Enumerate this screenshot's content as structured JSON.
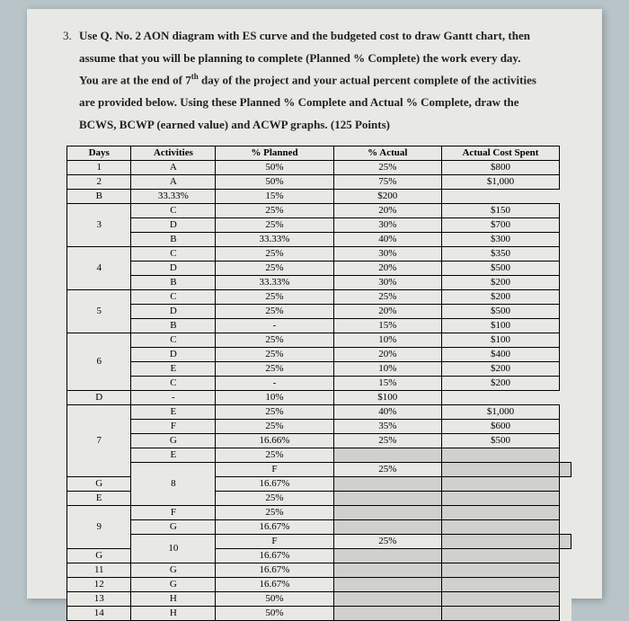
{
  "question": {
    "number": "3.",
    "line1_prefix": "Use Q. No. 2 AON diagram with ES curve and the budgeted cost to draw Gantt chart, then",
    "line2": "assume that you will be planning to complete (Planned % Complete) the work every day.",
    "line3_a": "You are at the end of 7",
    "line3_sup": "th",
    "line3_b": " day of the project and your actual percent complete of the activities",
    "line4": "are provided below. Using these Planned % Complete and Actual % Complete, draw the",
    "line5_a": "BCWS, BCWP (earned value) and ACWP graphs. ",
    "line5_b": "(125 Points)"
  },
  "headers": {
    "days": "Days",
    "activities": "Activities",
    "planned": "% Planned",
    "actual": "% Actual",
    "spent": "Actual Cost Spent"
  },
  "chart_data": {
    "type": "table",
    "columns": [
      "Days",
      "Activities",
      "% Planned",
      "% Actual",
      "Actual Cost Spent"
    ],
    "rows": [
      {
        "day": "1",
        "act": "A",
        "plan": "50%",
        "actual": "25%",
        "spent": "$800"
      },
      {
        "day": "2",
        "act": "A",
        "plan": "50%",
        "actual": "75%",
        "spent": "$1,000"
      },
      {
        "day": "",
        "act": "B",
        "plan": "33.33%",
        "actual": "15%",
        "spent": "$200"
      },
      {
        "day": "3",
        "act": "C",
        "plan": "25%",
        "actual": "20%",
        "spent": "$150"
      },
      {
        "day": "",
        "act": "D",
        "plan": "25%",
        "actual": "30%",
        "spent": "$700"
      },
      {
        "day": "",
        "act": "B",
        "plan": "33.33%",
        "actual": "40%",
        "spent": "$300"
      },
      {
        "day": "4",
        "act": "C",
        "plan": "25%",
        "actual": "30%",
        "spent": "$350"
      },
      {
        "day": "",
        "act": "D",
        "plan": "25%",
        "actual": "20%",
        "spent": "$500"
      },
      {
        "day": "",
        "act": "B",
        "plan": "33.33%",
        "actual": "30%",
        "spent": "$200"
      },
      {
        "day": "5",
        "act": "C",
        "plan": "25%",
        "actual": "25%",
        "spent": "$200"
      },
      {
        "day": "",
        "act": "D",
        "plan": "25%",
        "actual": "20%",
        "spent": "$500"
      },
      {
        "day": "",
        "act": "B",
        "plan": "-",
        "actual": "15%",
        "spent": "$100"
      },
      {
        "day": "6",
        "act": "C",
        "plan": "25%",
        "actual": "10%",
        "spent": "$100"
      },
      {
        "day": "",
        "act": "D",
        "plan": "25%",
        "actual": "20%",
        "spent": "$400"
      },
      {
        "day": "",
        "act": "E",
        "plan": "25%",
        "actual": "10%",
        "spent": "$200"
      },
      {
        "day": "",
        "act": "C",
        "plan": "-",
        "actual": "15%",
        "spent": "$200"
      },
      {
        "day": "",
        "act": "D",
        "plan": "-",
        "actual": "10%",
        "spent": "$100"
      },
      {
        "day": "7",
        "act": "E",
        "plan": "25%",
        "actual": "40%",
        "spent": "$1,000"
      },
      {
        "day": "",
        "act": "F",
        "plan": "25%",
        "actual": "35%",
        "spent": "$600"
      },
      {
        "day": "",
        "act": "G",
        "plan": "16.66%",
        "actual": "25%",
        "spent": "$500"
      },
      {
        "day": "",
        "act": "E",
        "plan": "25%",
        "actual": "",
        "spent": ""
      },
      {
        "day": "8",
        "act": "F",
        "plan": "25%",
        "actual": "",
        "spent": ""
      },
      {
        "day": "",
        "act": "G",
        "plan": "16.67%",
        "actual": "",
        "spent": ""
      },
      {
        "day": "",
        "act": "E",
        "plan": "25%",
        "actual": "",
        "spent": ""
      },
      {
        "day": "9",
        "act": "F",
        "plan": "25%",
        "actual": "",
        "spent": ""
      },
      {
        "day": "",
        "act": "G",
        "plan": "16.67%",
        "actual": "",
        "spent": ""
      },
      {
        "day": "10",
        "act": "F",
        "plan": "25%",
        "actual": "",
        "spent": ""
      },
      {
        "day": "",
        "act": "G",
        "plan": "16.67%",
        "actual": "",
        "spent": ""
      },
      {
        "day": "11",
        "act": "G",
        "plan": "16.67%",
        "actual": "",
        "spent": ""
      },
      {
        "day": "12",
        "act": "G",
        "plan": "16.67%",
        "actual": "",
        "spent": ""
      },
      {
        "day": "13",
        "act": "H",
        "plan": "50%",
        "actual": "",
        "spent": ""
      },
      {
        "day": "14",
        "act": "H",
        "plan": "50%",
        "actual": "",
        "spent": ""
      }
    ],
    "day_spans": {
      "1": 1,
      "2": 1,
      "3": 3,
      "4": 3,
      "5": 3,
      "6": 4,
      "7": 5,
      "8": 3,
      "9": 3,
      "10": 2,
      "11": 1,
      "12": 1,
      "13": 1,
      "14": 1
    }
  }
}
